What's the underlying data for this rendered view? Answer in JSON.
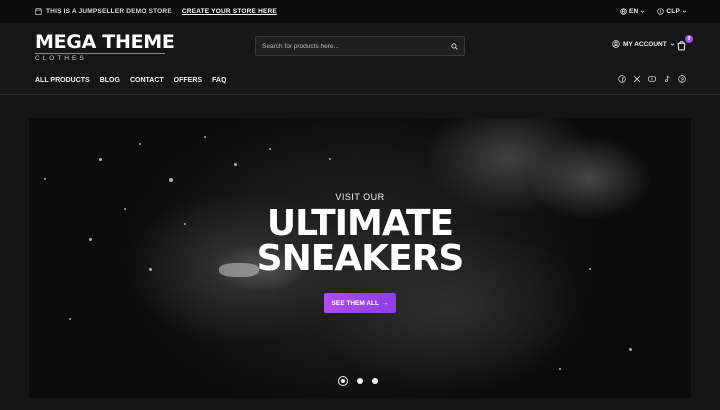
{
  "topbar": {
    "demo_text": "THIS IS A JUMPSELLER DEMO STORE",
    "create_link": "CREATE YOUR STORE HERE",
    "language": "EN",
    "currency": "CLP"
  },
  "header": {
    "logo_title": "MEGA THEME",
    "logo_subtitle": "CLOTHES",
    "search_placeholder": "Search for products here...",
    "account_label": "MY ACCOUNT",
    "cart_count": "0"
  },
  "nav": {
    "items": [
      "ALL PRODUCTS",
      "BLOG",
      "CONTACT",
      "OFFERS",
      "FAQ"
    ]
  },
  "social": [
    "facebook-icon",
    "x-icon",
    "youtube-icon",
    "tiktok-icon",
    "pinterest-icon"
  ],
  "hero": {
    "kicker": "VISIT OUR",
    "headline_line1": "ULTIMATE",
    "headline_line2": "SNEAKERS",
    "cta_label": "SEE THEM ALL",
    "slides_total": 3,
    "active_slide": 1
  },
  "colors": {
    "accent": "#a24ff0",
    "background": "#141414"
  }
}
